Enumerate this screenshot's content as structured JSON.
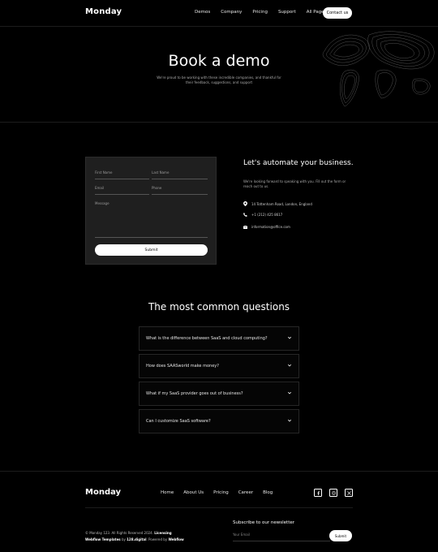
{
  "header": {
    "logo": "Monday",
    "nav": [
      "Demos",
      "Company",
      "Pricing",
      "Support",
      "All Pages"
    ],
    "contact_button": "Contact us"
  },
  "hero": {
    "title": "Book a demo",
    "subtitle": "We're proud to be working with these incredible companies, and thankful for their feedback, suggestions, and support"
  },
  "form": {
    "first_name": "First Name",
    "last_name": "Last Name",
    "email": "Email",
    "phone": "Phone",
    "message": "Message",
    "submit": "Submit"
  },
  "contact": {
    "title": "Let's automate your business.",
    "subtitle": "We're looking forward to speaking with you. Fill out the form or reach out to us.",
    "address": "14 Tottenham Road, London, England",
    "phone": "+1 (212) 425 8617",
    "email": "information@office.com"
  },
  "faq": {
    "title": "The most common questions",
    "items": [
      "What is the difference between SaaS and cloud computing?",
      "How does SAASworld make money?",
      "What if my SaaS provider goes out of business?",
      "Can I customize SaaS software?"
    ]
  },
  "footer": {
    "logo": "Monday",
    "links": [
      "Home",
      "About Us",
      "Pricing",
      "Career",
      "Blog"
    ],
    "copyright": "© Monday 123. All Rights Reserved 2024.",
    "licensing": "Licensing",
    "templates": "Webflow Templates",
    "by": "by",
    "agency": "128.digital",
    "powered": ". Powered by",
    "webflow": "Webflow",
    "newsletter_title": "Subscribe to our newsletter",
    "email_placeholder": "Your Email",
    "subscribe": "Submit"
  }
}
